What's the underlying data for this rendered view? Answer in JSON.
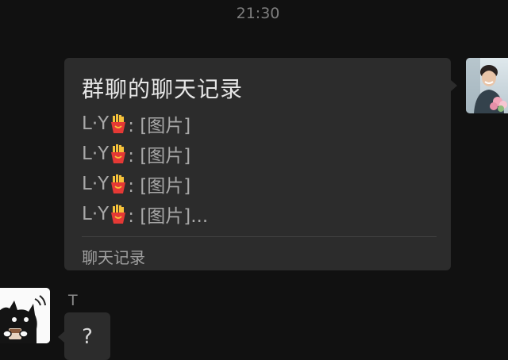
{
  "time": "21:30",
  "record_card": {
    "title": "群聊的聊天记录",
    "items": [
      {
        "sender": "L·Y",
        "icon": "french-fries-icon",
        "text": ": [图片]"
      },
      {
        "sender": "L·Y",
        "icon": "french-fries-icon",
        "text": ": [图片]"
      },
      {
        "sender": "L·Y",
        "icon": "french-fries-icon",
        "text": ": [图片]"
      },
      {
        "sender": "L·Y",
        "icon": "french-fries-icon",
        "text": ": [图片]..."
      }
    ],
    "footer": "聊天记录"
  },
  "incoming": {
    "sender_name": "T",
    "message": "?"
  },
  "colors": {
    "background": "#111111",
    "bubble": "#2c2c2c",
    "fries_box": "#e53935",
    "fries": "#f6c23a"
  }
}
